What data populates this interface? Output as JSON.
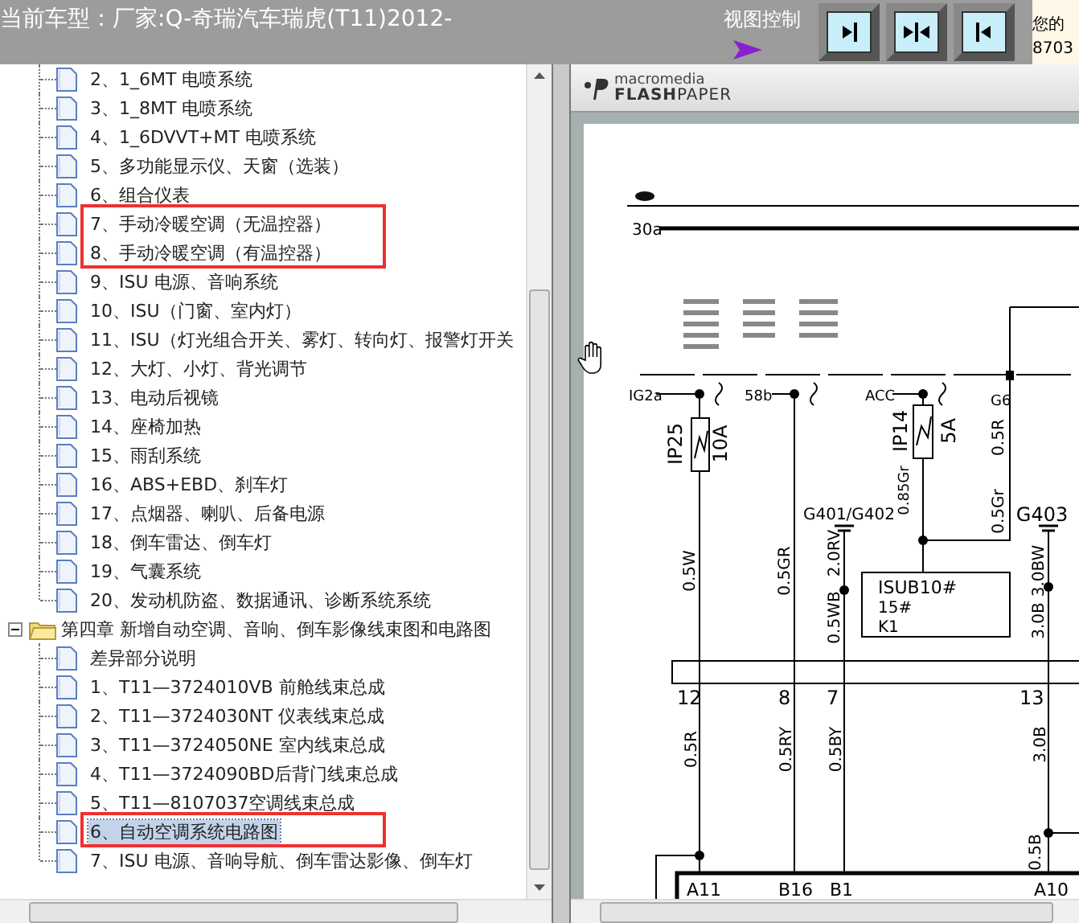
{
  "header": {
    "vehicle_model": "当前车型：厂家:Q-奇瑞汽车瑞虎(T11)2012-",
    "view_control_label": "视图控制",
    "side_text_lines": [
      "您的",
      "8703"
    ]
  },
  "tree": {
    "nodes": [
      {
        "children": [
          {
            "label": "2、1_6MT 电喷系统",
            "selected": false,
            "outlined": false
          },
          {
            "label": "3、1_8MT 电喷系统",
            "selected": false,
            "outlined": false
          },
          {
            "label": "4、1_6DVVT+MT 电喷系统",
            "selected": false,
            "outlined": false
          },
          {
            "label": "5、多功能显示仪、天窗（选装）",
            "selected": false,
            "outlined": false
          },
          {
            "label": "6、组合仪表",
            "selected": false,
            "outlined": false
          },
          {
            "label": "7、手动冷暖空调（无温控器）",
            "selected": false,
            "outlined": true
          },
          {
            "label": "8、手动冷暖空调（有温控器）",
            "selected": false,
            "outlined": true
          },
          {
            "label": "9、ISU 电源、音响系统",
            "selected": false,
            "outlined": false
          },
          {
            "label": "10、ISU（门窗、室内灯）",
            "selected": false,
            "outlined": false
          },
          {
            "label": "11、ISU（灯光组合开关、雾灯、转向灯、报警灯开关",
            "selected": false,
            "outlined": false
          },
          {
            "label": "12、大灯、小灯、背光调节",
            "selected": false,
            "outlined": false
          },
          {
            "label": "13、电动后视镜",
            "selected": false,
            "outlined": false
          },
          {
            "label": "14、座椅加热",
            "selected": false,
            "outlined": false
          },
          {
            "label": "15、雨刮系统",
            "selected": false,
            "outlined": false
          },
          {
            "label": "16、ABS+EBD、刹车灯",
            "selected": false,
            "outlined": false
          },
          {
            "label": "17、点烟器、喇叭、后备电源",
            "selected": false,
            "outlined": false
          },
          {
            "label": "18、倒车雷达、倒车灯",
            "selected": false,
            "outlined": false
          },
          {
            "label": "19、气囊系统",
            "selected": false,
            "outlined": false
          },
          {
            "label": "20、发动机防盗、数据通讯、诊断系统系统",
            "selected": false,
            "outlined": false
          }
        ]
      },
      {
        "label": "第四章 新增自动空调、音响、倒车影像线束图和电路图",
        "expanded": true,
        "children": [
          {
            "label": "差异部分说明",
            "selected": false,
            "outlined": false
          },
          {
            "label": "1、T11—3724010VB 前舱线束总成",
            "selected": false,
            "outlined": false
          },
          {
            "label": "2、T11—3724030NT 仪表线束总成",
            "selected": false,
            "outlined": false
          },
          {
            "label": "3、T11—3724050NE 室内线束总成",
            "selected": false,
            "outlined": false
          },
          {
            "label": "4、T11—3724090BD后背门线束总成",
            "selected": false,
            "outlined": false
          },
          {
            "label": "5、T11—8107037空调线束总成",
            "selected": false,
            "outlined": false
          },
          {
            "label": "6、自动空调系统电路图",
            "selected": true,
            "outlined": true
          },
          {
            "label": "7、ISU 电源、音响导航、倒车雷达影像、倒车灯",
            "selected": false,
            "outlined": false
          }
        ]
      }
    ]
  },
  "viewer": {
    "brand_top": "macromedia",
    "brand_name": "**FLASH**PAPER",
    "diagram_labels": [
      "30a",
      "IG2a",
      "58b",
      "ACC",
      "G6",
      "IP25",
      "10A",
      "IP14",
      "5A",
      "0.5W",
      "0.5GR",
      "2.0RV",
      "0.5WB",
      "0.85Gr",
      "0.5Gr",
      "0.5R",
      "G401/G402",
      "G403",
      "3.0BW",
      "3.0B",
      "12",
      "8",
      "7",
      "13",
      "0.5R",
      "0.5RY",
      "0.5BY",
      "3.0B",
      "0.5B",
      "A11",
      "B16",
      "B1",
      "A10"
    ],
    "module_box_lines": [
      "ISUB10#",
      "15#",
      "K1"
    ]
  }
}
